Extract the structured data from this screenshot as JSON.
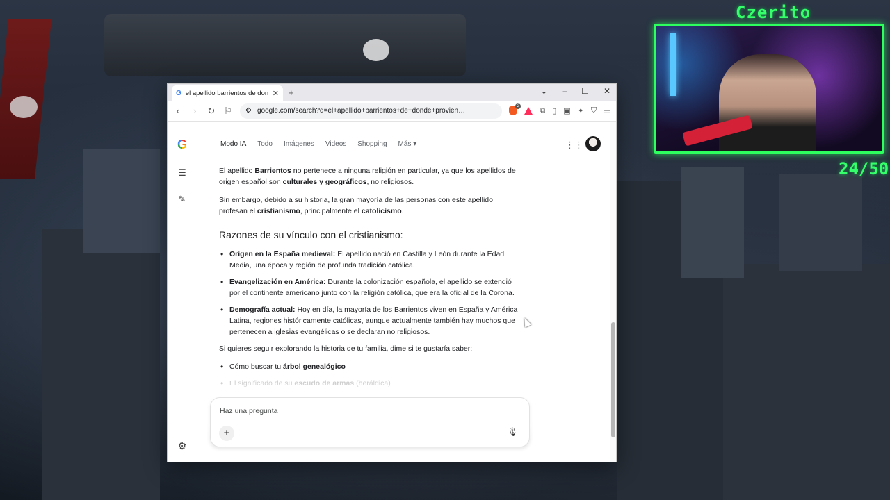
{
  "stream_overlay": {
    "streamer_name": "Czerito",
    "counter": "24/50"
  },
  "browser": {
    "tab_title": "el apellido barrientos de donde pr",
    "new_tab_symbol": "+",
    "url": "google.com/search?q=el+apellido+barrientos+de+donde+provien…",
    "extension_badge_count": "2"
  },
  "google": {
    "nav_tabs": [
      "Modo IA",
      "Todo",
      "Imágenes",
      "Videos",
      "Shopping",
      "Más ▾"
    ],
    "answer": {
      "p1_pre": "El apellido ",
      "p1_b1": "Barrientos",
      "p1_mid": " no pertenece a ninguna religión en particular, ya que los apellidos de origen español son ",
      "p1_b2": "culturales y geográficos",
      "p1_post": ", no religiosos.",
      "p2_pre": "Sin embargo, debido a su historia, la gran mayoría de las personas con este apellido profesan el ",
      "p2_b1": "cristianismo",
      "p2_mid": ", principalmente el ",
      "p2_b2": "catolicismo",
      "p2_post": ".",
      "heading": "Razones de su vínculo con el cristianismo:",
      "reasons": [
        {
          "title": "Origen en la España medieval:",
          "text": " El apellido nació en Castilla y León durante la Edad Media, una época y región de profunda tradición católica."
        },
        {
          "title": "Evangelización en América:",
          "text": " Durante la colonización española, el apellido se extendió por el continente americano junto con la religión católica, que era la oficial de la Corona."
        },
        {
          "title": "Demografía actual:",
          "text": " Hoy en día, la mayoría de los Barrientos viven en España y América Latina, regiones históricamente católicas, aunque actualmente también hay muchos que pertenecen a iglesias evangélicas o se declaran no religiosos."
        }
      ],
      "followup": "Si quieres seguir explorando la historia de tu familia, dime si te gustaría saber:",
      "followup_items": [
        {
          "pre": "Cómo buscar tu ",
          "bold": "árbol genealógico",
          "post": ""
        },
        {
          "pre": "El significado de su ",
          "bold": "escudo de armas",
          "post": " (heráldica)"
        }
      ]
    },
    "composer_placeholder": "Haz una pregunta"
  },
  "icons": {
    "back": "arrow-left-icon",
    "forward": "arrow-right-icon",
    "reload": "reload-icon",
    "bookmark": "bookmark-icon",
    "apps": "apps-grid-icon",
    "settings": "gear-icon",
    "mic": "microphone-icon"
  },
  "colors": {
    "overlay_green": "#35ff6a",
    "brave_orange": "#f25a22"
  }
}
